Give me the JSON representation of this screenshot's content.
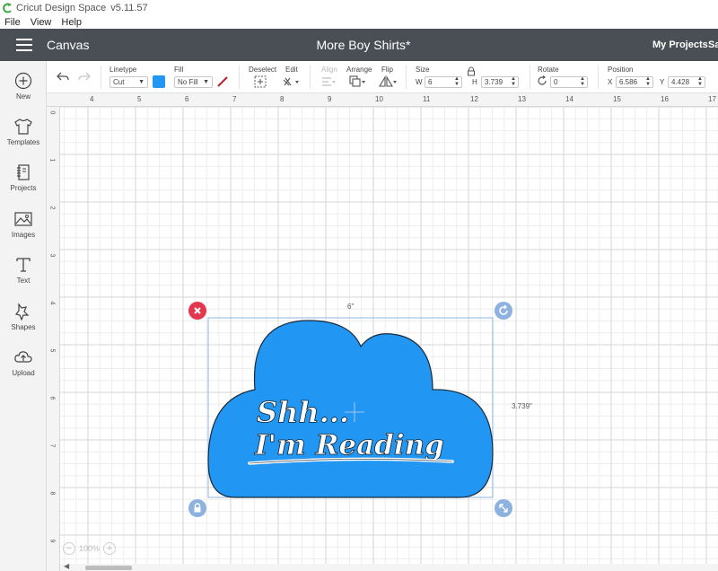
{
  "window": {
    "app_name": "Cricut Design Space",
    "version": "v5.11.57"
  },
  "menu": [
    "File",
    "View",
    "Help"
  ],
  "header": {
    "canvas_label": "Canvas",
    "project_title": "More Boy Shirts*",
    "my_projects": "My Projects",
    "save_label_truncated": "Sa"
  },
  "sidebar": {
    "items": [
      {
        "label": "New",
        "icon": "plus-circle-icon"
      },
      {
        "label": "Templates",
        "icon": "shirt-icon"
      },
      {
        "label": "Projects",
        "icon": "notebook-icon"
      },
      {
        "label": "Images",
        "icon": "image-icon"
      },
      {
        "label": "Text",
        "icon": "text-icon"
      },
      {
        "label": "Shapes",
        "icon": "shapes-icon"
      },
      {
        "label": "Upload",
        "icon": "cloud-upload-icon"
      }
    ]
  },
  "toolbar": {
    "linetype_label": "Linetype",
    "linetype_value": "Cut",
    "linetype_color": "#2196f3",
    "fill_label": "Fill",
    "fill_value": "No Fill",
    "deselect_label": "Deselect",
    "edit_label": "Edit",
    "align_label": "Align",
    "arrange_label": "Arrange",
    "flip_label": "Flip",
    "size_label": "Size",
    "width_letter": "W",
    "width_value": "6",
    "height_letter": "H",
    "height_value": "3.739",
    "rotate_label": "Rotate",
    "rotate_value": "0",
    "position_label": "Position",
    "x_letter": "X",
    "x_value": "6.586",
    "y_letter": "Y",
    "y_value": "4.428"
  },
  "ruler": {
    "top": [
      "4",
      "5",
      "6",
      "7",
      "8",
      "9",
      "10",
      "11",
      "12",
      "13",
      "14",
      "15",
      "16",
      "17"
    ],
    "left": [
      "0",
      "1",
      "2",
      "3",
      "4",
      "5",
      "6",
      "7",
      "8",
      "9"
    ]
  },
  "design": {
    "text_line1": "Shh...",
    "text_line2": "I'm Reading",
    "width_label": "6\"",
    "height_label": "3.739\"",
    "fill_color": "#2196f3"
  },
  "zoom": {
    "value": "100%"
  }
}
